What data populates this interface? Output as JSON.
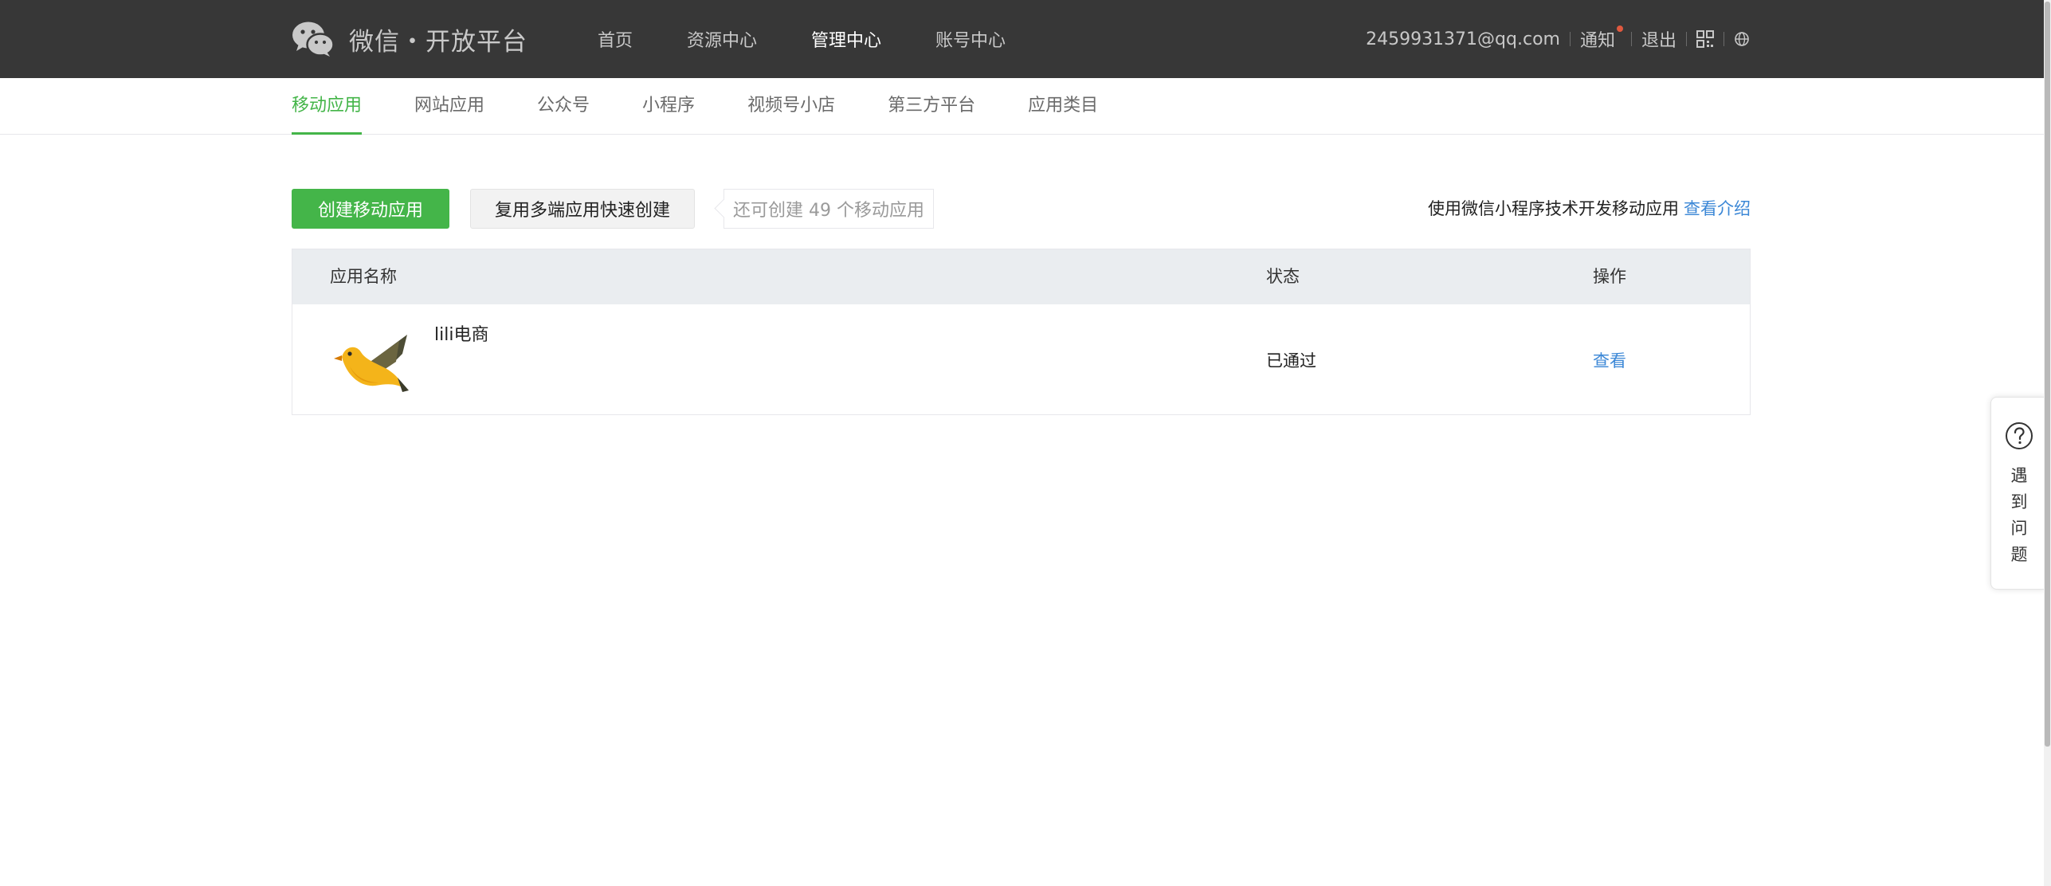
{
  "header": {
    "logo_text": "微信・开放平台",
    "nav": [
      {
        "label": "首页"
      },
      {
        "label": "资源中心"
      },
      {
        "label": "管理中心",
        "active": true
      },
      {
        "label": "账号中心"
      }
    ],
    "user_email": "2459931371@qq.com",
    "notify_label": "通知",
    "logout_label": "退出",
    "qr_icon": "qrcode-icon",
    "globe_icon": "globe-icon"
  },
  "subnav": {
    "items": [
      {
        "label": "移动应用",
        "active": true
      },
      {
        "label": "网站应用"
      },
      {
        "label": "公众号"
      },
      {
        "label": "小程序"
      },
      {
        "label": "视频号小店"
      },
      {
        "label": "第三方平台"
      },
      {
        "label": "应用类目"
      }
    ]
  },
  "toolbar": {
    "create_label": "创建移动应用",
    "reuse_label": "复用多端应用快速创建",
    "quota_tip": "还可创建 49 个移动应用",
    "intro_text": "使用微信小程序技术开发移动应用",
    "intro_link": "查看介绍"
  },
  "table": {
    "headers": {
      "name": "应用名称",
      "status": "状态",
      "action": "操作"
    },
    "rows": [
      {
        "icon": "bird-icon",
        "name": "lili电商",
        "status": "已通过",
        "action": "查看"
      }
    ]
  },
  "help": {
    "icon": "question-circle-icon",
    "chars": [
      "遇",
      "到",
      "问",
      "题"
    ]
  },
  "colors": {
    "header_bg": "#373737",
    "accent_green": "#44b549",
    "link_blue": "#3b87d6",
    "table_head_bg": "#eaedf0"
  }
}
